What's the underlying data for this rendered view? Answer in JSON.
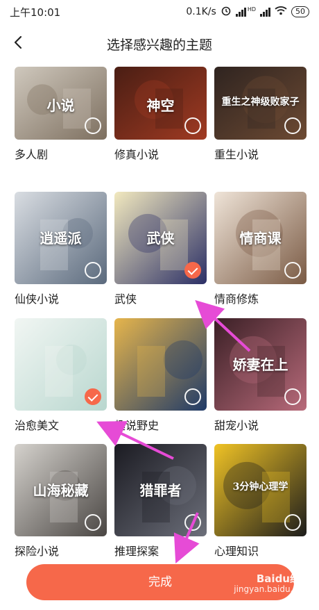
{
  "status_bar": {
    "time": "上午10:01",
    "net_speed": "0.1K/s",
    "hd_label": "HD",
    "battery": "50"
  },
  "header": {
    "title": "选择感兴趣的主题"
  },
  "topics": [
    {
      "label": "多人剧",
      "cover_text": "小说",
      "selected": false,
      "colors": [
        "#cfc8bd",
        "#7d6f5f"
      ]
    },
    {
      "label": "修真小说",
      "cover_text": "神空",
      "selected": false,
      "colors": [
        "#4a1e14",
        "#a03a22"
      ]
    },
    {
      "label": "重生小说",
      "cover_text": "重生之神级败家子",
      "selected": false,
      "colors": [
        "#2f2420",
        "#6d4a33"
      ]
    },
    {
      "label": "仙侠小说",
      "cover_text": "逍遥派",
      "selected": false,
      "colors": [
        "#d9dde2",
        "#5b6a7d"
      ]
    },
    {
      "label": "武侠",
      "cover_text": "武侠",
      "selected": true,
      "colors": [
        "#f2e9bf",
        "#2b2f66"
      ]
    },
    {
      "label": "情商修炼",
      "cover_text": "情商课",
      "selected": false,
      "colors": [
        "#efe4d8",
        "#7a5a44"
      ]
    },
    {
      "label": "治愈美文",
      "cover_text": "",
      "selected": true,
      "colors": [
        "#f1f6f3",
        "#b9d7cf"
      ]
    },
    {
      "label": "趣说野史",
      "cover_text": "",
      "selected": false,
      "colors": [
        "#e6b54c",
        "#1f3a68"
      ]
    },
    {
      "label": "甜宠小说",
      "cover_text": "娇妻在上",
      "selected": false,
      "colors": [
        "#3b2026",
        "#b86a7a"
      ]
    },
    {
      "label": "探险小说",
      "cover_text": "山海秘藏",
      "selected": false,
      "colors": [
        "#d5d2cd",
        "#4a4643"
      ]
    },
    {
      "label": "推理探案",
      "cover_text": "猎罪者",
      "selected": false,
      "colors": [
        "#1b1b22",
        "#6c6f7a"
      ]
    },
    {
      "label": "心理知识",
      "cover_text": "3分钟心理学",
      "selected": false,
      "colors": [
        "#f0c325",
        "#1c1c1c"
      ]
    }
  ],
  "done_button": {
    "label": "完成"
  },
  "watermark": {
    "brand": "Baidu经验",
    "url": "jingyan.baidu.com"
  },
  "accent_color": "#f6684a",
  "annotation_color": "#e64bd6"
}
